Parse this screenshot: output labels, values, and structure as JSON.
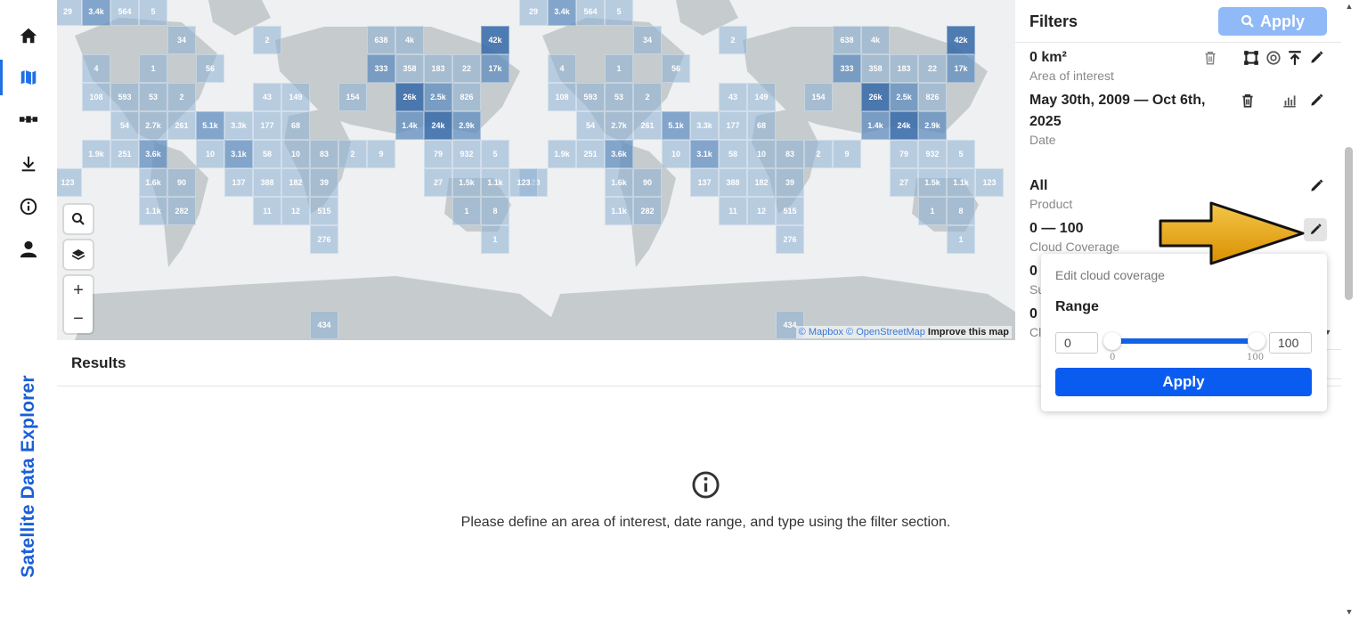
{
  "brand": "Satellite Data Explorer",
  "nav": [
    {
      "id": "home",
      "icon": "home-icon"
    },
    {
      "id": "map",
      "icon": "map-icon",
      "active": true
    },
    {
      "id": "satellite",
      "icon": "satellite-icon"
    },
    {
      "id": "download",
      "icon": "download-icon"
    },
    {
      "id": "info",
      "icon": "info-icon"
    },
    {
      "id": "account",
      "icon": "user-icon"
    }
  ],
  "map": {
    "attribution_mapbox": "© Mapbox",
    "attribution_osm": "© OpenStreetMap",
    "improve": "Improve this map",
    "tiles": [
      [
        "29",
        0,
        0,
        1
      ],
      [
        "3.4k",
        1,
        0,
        2
      ],
      [
        "564",
        2,
        0,
        1
      ],
      [
        "5",
        3,
        0,
        1
      ],
      [
        "34",
        4,
        1,
        1
      ],
      [
        "2",
        7,
        1,
        1
      ],
      [
        "638",
        11,
        1,
        1
      ],
      [
        "4k",
        12,
        1,
        1
      ],
      [
        "42k",
        15,
        1,
        3
      ],
      [
        "4",
        1,
        2,
        1
      ],
      [
        "1",
        3,
        2,
        1
      ],
      [
        "56",
        5,
        2,
        1
      ],
      [
        "333",
        11,
        2,
        2
      ],
      [
        "358",
        12,
        2,
        1
      ],
      [
        "183",
        13,
        2,
        1
      ],
      [
        "22",
        14,
        2,
        1
      ],
      [
        "17k",
        15,
        2,
        2
      ],
      [
        "108",
        1,
        3,
        1
      ],
      [
        "593",
        2,
        3,
        1
      ],
      [
        "53",
        3,
        3,
        1
      ],
      [
        "2",
        4,
        3,
        1
      ],
      [
        "43",
        7,
        3,
        1
      ],
      [
        "149",
        8,
        3,
        1
      ],
      [
        "154",
        10,
        3,
        1
      ],
      [
        "26k",
        12,
        3,
        3
      ],
      [
        "2.5k",
        13,
        3,
        2
      ],
      [
        "826",
        14,
        3,
        1
      ],
      [
        "54",
        2,
        4,
        1
      ],
      [
        "2.7k",
        3,
        4,
        1
      ],
      [
        "261",
        4,
        4,
        1
      ],
      [
        "5.1k",
        5,
        4,
        2
      ],
      [
        "3.3k",
        6,
        4,
        1
      ],
      [
        "177",
        7,
        4,
        1
      ],
      [
        "68",
        8,
        4,
        1
      ],
      [
        "1.4k",
        12,
        4,
        2
      ],
      [
        "24k",
        13,
        4,
        3
      ],
      [
        "2.9k",
        14,
        4,
        2
      ],
      [
        "1.9k",
        1,
        5,
        1
      ],
      [
        "251",
        2,
        5,
        1
      ],
      [
        "3.6k",
        3,
        5,
        2
      ],
      [
        "10",
        5,
        5,
        1
      ],
      [
        "3.1k",
        6,
        5,
        2
      ],
      [
        "58",
        7,
        5,
        1
      ],
      [
        "10",
        8,
        5,
        1
      ],
      [
        "83",
        9,
        5,
        1
      ],
      [
        "2",
        10,
        5,
        1
      ],
      [
        "9",
        11,
        5,
        1
      ],
      [
        "79",
        13,
        5,
        1
      ],
      [
        "932",
        14,
        5,
        1
      ],
      [
        "5",
        15,
        5,
        1
      ],
      [
        "123",
        0,
        6,
        1
      ],
      [
        "1.6k",
        3,
        6,
        1
      ],
      [
        "90",
        4,
        6,
        1
      ],
      [
        "137",
        6,
        6,
        1
      ],
      [
        "388",
        7,
        6,
        1
      ],
      [
        "182",
        8,
        6,
        1
      ],
      [
        "39",
        9,
        6,
        1
      ],
      [
        "27",
        13,
        6,
        1
      ],
      [
        "1.5k",
        14,
        6,
        1
      ],
      [
        "1.1k",
        15,
        6,
        1
      ],
      [
        "123",
        16,
        6,
        1
      ],
      [
        "1.1k",
        3,
        7,
        1
      ],
      [
        "282",
        4,
        7,
        1
      ],
      [
        "11",
        7,
        7,
        1
      ],
      [
        "12",
        8,
        7,
        1
      ],
      [
        "515",
        9,
        7,
        1
      ],
      [
        "1",
        14,
        7,
        1
      ],
      [
        "8",
        15,
        7,
        1
      ],
      [
        "276",
        9,
        8,
        1
      ],
      [
        "1",
        15,
        8,
        1
      ],
      [
        "434",
        9,
        11,
        1
      ]
    ]
  },
  "filters": {
    "title": "Filters",
    "apply": "Apply",
    "area": {
      "value": "0 km²",
      "label": "Area of interest"
    },
    "date": {
      "value_line1": "May 30th, 2009 — Oct 6th,",
      "value_line2": "2025",
      "label": "Date"
    },
    "product": {
      "value": "All",
      "label": "Product"
    },
    "cloud": {
      "value": "0 — 100",
      "label": "Cloud Coverage"
    },
    "partial1": {
      "value": "0",
      "label": "Su"
    },
    "partial2": {
      "value": "0",
      "label": "Cl"
    }
  },
  "popover": {
    "title": "Edit cloud coverage",
    "range_label": "Range",
    "min_value": "0",
    "max_value": "100",
    "min_tick": "0",
    "max_tick": "100",
    "apply": "Apply"
  },
  "results": {
    "title": "Results",
    "empty_message": "Please define an area of interest, date range, and type using the filter section."
  },
  "colors": {
    "accent": "#0a5cf0",
    "apply_disabled": "#8fb9f7",
    "brand_text": "#1a5fd6",
    "annotation_arrow": "#e6a50a"
  }
}
